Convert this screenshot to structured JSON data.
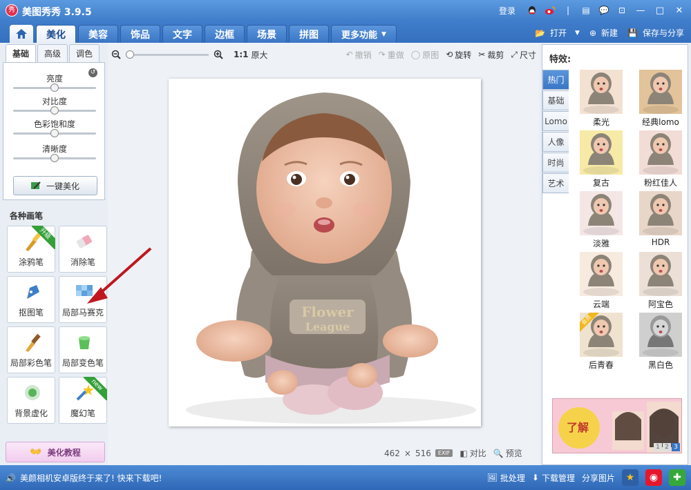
{
  "app": {
    "title": "美图秀秀 3.9.5",
    "logo_text": "秀",
    "login": "登录"
  },
  "nav": {
    "tabs": [
      "美化",
      "美容",
      "饰品",
      "文字",
      "边框",
      "场景",
      "拼图"
    ],
    "more": "更多功能",
    "open": "打开",
    "new": "新建",
    "save_share": "保存与分享"
  },
  "left": {
    "subtabs": [
      "基础",
      "高级",
      "调色"
    ],
    "sliders": [
      {
        "label": "亮度",
        "level": 0.5
      },
      {
        "label": "对比度",
        "level": 0.5
      },
      {
        "label": "色彩饱和度",
        "level": 0.5
      },
      {
        "label": "清晰度",
        "level": 0.5
      }
    ],
    "onekey": "一键美化",
    "brush_title": "各种画笔",
    "brushes": [
      {
        "label": "涂鸦笔",
        "badge": "升级",
        "icon": "paintbrush-icon"
      },
      {
        "label": "消除笔",
        "badge": "",
        "icon": "eraser-icon"
      },
      {
        "label": "抠图笔",
        "badge": "",
        "icon": "pen-nib-icon"
      },
      {
        "label": "局部马赛克",
        "badge": "",
        "icon": "mosaic-icon"
      },
      {
        "label": "局部彩色笔",
        "badge": "",
        "icon": "color-brush-icon"
      },
      {
        "label": "局部变色笔",
        "badge": "",
        "icon": "paint-bucket-icon"
      },
      {
        "label": "背景虚化",
        "badge": "",
        "icon": "blur-icon"
      },
      {
        "label": "魔幻笔",
        "badge": "new",
        "icon": "magic-wand-icon"
      }
    ],
    "tutorial": "美化教程"
  },
  "toolbar": {
    "ratio": "1:1",
    "original_size": "原大",
    "undo": "撤销",
    "redo": "重做",
    "original": "原图",
    "rotate": "旋转",
    "crop": "裁剪",
    "size": "尺寸"
  },
  "status": {
    "width": "462",
    "times": "×",
    "height": "516",
    "exif": "EXIF",
    "compare": "对比",
    "preview": "预览"
  },
  "right": {
    "title": "特效:",
    "categories": [
      "热门",
      "基础",
      "Lomo",
      "人像",
      "时尚",
      "艺术"
    ],
    "effects": [
      {
        "name": "柔光",
        "tint": "#f3e2d2",
        "badge": ""
      },
      {
        "name": "经典lomo",
        "tint": "#e3c39a",
        "badge": ""
      },
      {
        "name": "复古",
        "tint": "#f7eaa6",
        "badge": ""
      },
      {
        "name": "粉红佳人",
        "tint": "#f2dcd6",
        "badge": ""
      },
      {
        "name": "淡雅",
        "tint": "#f5e6e6",
        "badge": ""
      },
      {
        "name": "HDR",
        "tint": "#e8d6c8",
        "badge": ""
      },
      {
        "name": "云端",
        "tint": "#f7eadf",
        "badge": ""
      },
      {
        "name": "阿宝色",
        "tint": "#ece0d6",
        "badge": ""
      },
      {
        "name": "后青春",
        "tint": "#efe3cf",
        "badge": "会员"
      },
      {
        "name": "黑白色",
        "tint": "#cfcfcf",
        "badge": ""
      }
    ],
    "ad_pages": [
      "1",
      "2",
      "3"
    ],
    "ad_text": "了解"
  },
  "bottom": {
    "notice": "美颜相机安卓版终于来了! 快来下载吧!",
    "batch": "批处理",
    "download": "下载管理",
    "share": "分享图片"
  }
}
